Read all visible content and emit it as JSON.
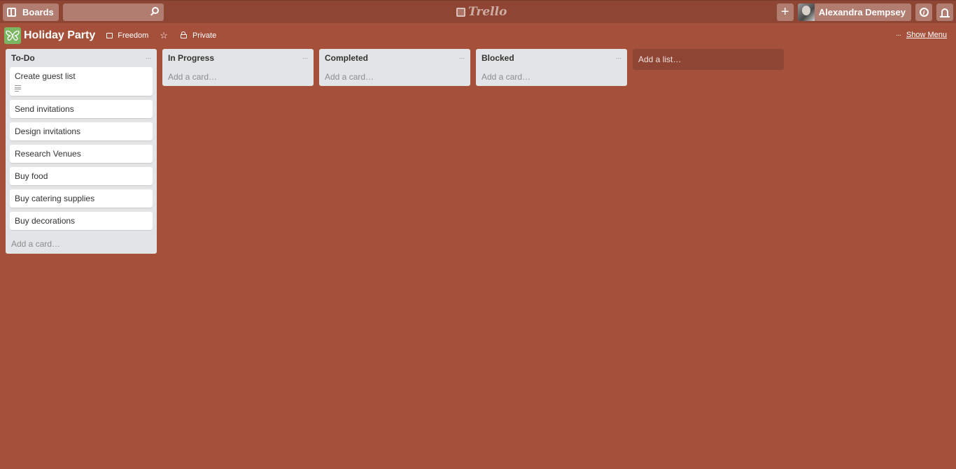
{
  "topbar": {
    "boards_label": "Boards",
    "search_placeholder": "",
    "logo_text": "Trello",
    "user_name": "Alexandra Dempsey",
    "add_icon": "plus-icon",
    "info_icon": "info-icon",
    "notifications_icon": "bell-icon"
  },
  "board": {
    "title": "Holiday Party",
    "team": "Freedom",
    "visibility": "Private",
    "show_menu_label": "Show Menu",
    "colors": {
      "background": "#a5503b",
      "topbar": "#8f4533",
      "board_icon": "#7bb662"
    }
  },
  "lists": [
    {
      "title": "To-Do",
      "cards": [
        {
          "title": "Create guest list",
          "has_description": true
        },
        {
          "title": "Send invitations"
        },
        {
          "title": "Design invitations"
        },
        {
          "title": "Research Venues"
        },
        {
          "title": "Buy food"
        },
        {
          "title": "Buy catering supplies"
        },
        {
          "title": "Buy decorations"
        }
      ],
      "add_card_label": "Add a card…"
    },
    {
      "title": "In Progress",
      "cards": [],
      "add_card_label": "Add a card…"
    },
    {
      "title": "Completed",
      "cards": [],
      "add_card_label": "Add a card…"
    },
    {
      "title": "Blocked",
      "cards": [],
      "add_card_label": "Add a card…"
    }
  ],
  "add_list_label": "Add a list…",
  "list_menu_glyph": "···"
}
